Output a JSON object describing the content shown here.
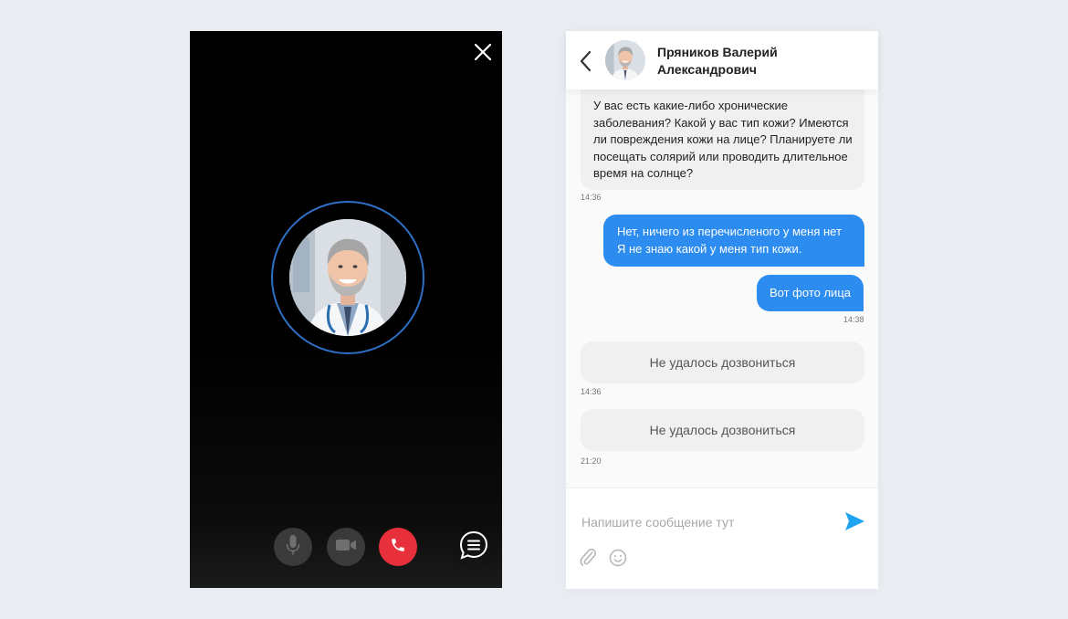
{
  "call": {
    "close_icon": "close-icon",
    "avatar_icon": "doctor-avatar",
    "controls": {
      "mic_icon": "microphone-icon",
      "camera_icon": "video-camera-icon",
      "end_icon": "phone-hangup-icon",
      "chat_icon": "chat-bubble-icon"
    },
    "colors": {
      "ring": "#2f6fc5",
      "end_button": "#e8303c",
      "control_bg": "#3a3a3a"
    }
  },
  "chat": {
    "header": {
      "back_icon": "chevron-left-icon",
      "name_line1": "Пряников Валерий",
      "name_line2": "Александрович"
    },
    "messages": [
      {
        "direction": "in",
        "lines": [
          "У вас есть какие-либо хронические",
          "заболевания? Какой у вас тип кожи? Имеются",
          "ли повреждения кожи на лице? Планируете ли",
          "посещать солярий или проводить длительное",
          "время на солнце?"
        ],
        "time": "14:36"
      },
      {
        "direction": "out",
        "lines": [
          "Нет, ничего из перечисленого у меня нет",
          "Я не знаю какой у меня тип кожи."
        ]
      },
      {
        "direction": "out",
        "lines": [
          "Вот фото лица"
        ],
        "time": "14:38"
      },
      {
        "direction": "system",
        "text": "Не удалось дозвониться",
        "time": "14:36"
      },
      {
        "direction": "system",
        "text": "Не удалось дозвониться",
        "time": "21:20"
      }
    ],
    "composer": {
      "placeholder": "Напишите сообщение тут",
      "value": "",
      "send_icon": "send-icon",
      "attach_icon": "paperclip-icon",
      "emoji_icon": "emoji-icon"
    },
    "colors": {
      "outgoing": "#2d8cf0",
      "incoming": "#f0f0f0",
      "send": "#1ea3f0"
    }
  }
}
